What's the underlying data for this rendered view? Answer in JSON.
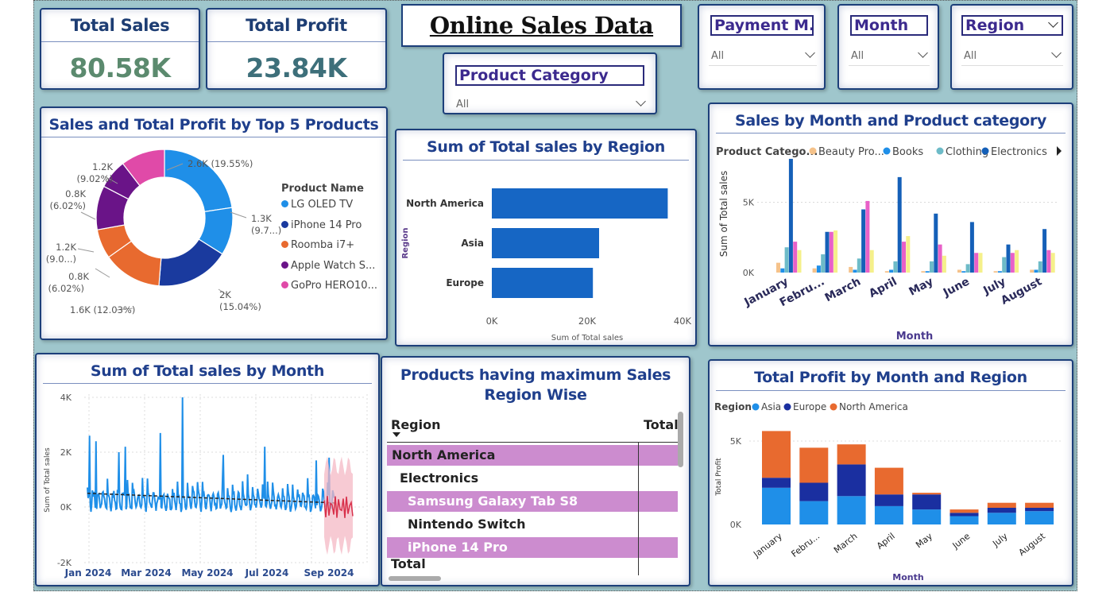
{
  "dashboard_title": "Online Sales Data",
  "kpis": [
    {
      "title": "Total Sales",
      "value": "80.58K",
      "color": "#5b8a6e"
    },
    {
      "title": "Total Profit",
      "value": "23.84K",
      "color": "#3d6f7a"
    }
  ],
  "slicers": {
    "product_category": {
      "label": "Product Category",
      "value": "All"
    },
    "payment": {
      "label": "Payment M...",
      "value": "All"
    },
    "month": {
      "label": "Month",
      "value": "All"
    },
    "region": {
      "label": "Region",
      "value": "All"
    }
  },
  "donut": {
    "title": "Sales and Total Profit by Top 5 Products",
    "legend_title": "Product Name",
    "colors": [
      "#1f8fe8",
      "#1a3a9e",
      "#e86a2f",
      "#6a1488",
      "#e04aa8"
    ],
    "labels_text": [
      "2.6K (19.55%)",
      "1.3K",
      "(9.7...)",
      "2K",
      "(15.04%)",
      "1.6K (12.03%)",
      "0.8K",
      "(6.02%)",
      "1.2K",
      "(9.0...)",
      "0.8K",
      "(6.02%)",
      "1.2K",
      "(9.02%)"
    ]
  },
  "region_bar": {
    "title": "Sum of Total sales by Region",
    "ylabel": "Region",
    "xlabel": "Sum of Total sales",
    "ticks": [
      "0K",
      "20K",
      "40K"
    ]
  },
  "month_category": {
    "title": "Sales by Month and Product category",
    "legend_title": "Product Catego...",
    "legend": [
      "Beauty Pro...",
      "Books",
      "Clothing",
      "Electronics"
    ],
    "ylabel": "Sum of Total sales",
    "xlabel": "Month",
    "yticks": [
      "5K",
      "0K"
    ],
    "months": [
      "January",
      "Febru...",
      "March",
      "April",
      "May",
      "June",
      "July",
      "August"
    ],
    "colors": [
      "#f5c28a",
      "#1f8fe8",
      "#6dbbc8",
      "#1560b8",
      "#e860c8",
      "#f5f08a"
    ]
  },
  "line": {
    "title": "Sum of Total sales by Month",
    "ylabel": "Sum of Total sales",
    "yticks": [
      "4K",
      "2K",
      "0K",
      "-2K"
    ],
    "xticks": [
      "Jan 2024",
      "Mar 2024",
      "May 2024",
      "Jul 2024",
      "Sep 2024"
    ]
  },
  "table": {
    "title_line1": "Products having maximum Sales",
    "title_line2": "Region Wise",
    "col_region": "Region",
    "col_total": "Total",
    "rows": [
      {
        "text": "North America",
        "level": 0,
        "hl": true
      },
      {
        "text": "Electronics",
        "level": 1,
        "hl": false
      },
      {
        "text": "Samsung Galaxy Tab S8",
        "level": 2,
        "hl": true
      },
      {
        "text": "Nintendo Switch",
        "level": 2,
        "hl": false
      },
      {
        "text": "iPhone 14 Pro",
        "level": 2,
        "hl": true
      }
    ],
    "total_label": "Total"
  },
  "profit_region": {
    "title": "Total Profit by Month and Region",
    "legend_title": "Region",
    "legend": [
      "Asia",
      "Europe",
      "North America"
    ],
    "colors": [
      "#1f8fe8",
      "#1a2fa0",
      "#e86a2f"
    ],
    "ylabel": "Total Profit",
    "xlabel": "Month",
    "yticks": [
      "5K",
      "0K"
    ],
    "months": [
      "January",
      "Febru...",
      "March",
      "April",
      "May",
      "June",
      "July",
      "August"
    ]
  },
  "chart_data": [
    {
      "type": "pie",
      "title": "Sales and Total Profit by Top 5 Products",
      "categories": [
        "LG OLED TV",
        "iPhone 14 Pro",
        "Roomba i7+",
        "Apple Watch S...",
        "GoPro HERO10..."
      ],
      "values": [
        2600,
        1300,
        2000,
        1600,
        800,
        1200,
        800,
        1200
      ],
      "segment_names": [
        "LG OLED TV",
        "LG OLED TV",
        "iPhone 14 Pro",
        "Roomba i7+",
        "Roomba i7+",
        "Apple Watch S...",
        "Apple Watch S...",
        "GoPro HERO10..."
      ],
      "segment_colors": [
        0,
        0,
        1,
        2,
        2,
        3,
        3,
        4
      ]
    },
    {
      "type": "bar",
      "title": "Sum of Total sales by Region",
      "categories": [
        "North America",
        "Asia",
        "Europe"
      ],
      "values": [
        36900,
        22500,
        21200
      ],
      "xlim": [
        0,
        40000
      ]
    },
    {
      "type": "bar",
      "title": "Sales by Month and Product category",
      "categories": [
        "January",
        "Febru...",
        "March",
        "April",
        "May",
        "June",
        "July",
        "August"
      ],
      "series": [
        {
          "name": "Beauty Pro...",
          "values": [
            700,
            300,
            400,
            100,
            100,
            200,
            100,
            200
          ]
        },
        {
          "name": "Books",
          "values": [
            300,
            500,
            200,
            200,
            100,
            100,
            100,
            200
          ]
        },
        {
          "name": "Clothing",
          "values": [
            1800,
            1300,
            1000,
            800,
            800,
            600,
            1100,
            800
          ]
        },
        {
          "name": "Electronics",
          "values": [
            8100,
            2900,
            4500,
            6800,
            4200,
            3600,
            2000,
            3100
          ]
        },
        {
          "name": "",
          "values": [
            2200,
            2900,
            5100,
            2200,
            2000,
            1400,
            1400,
            1600
          ]
        },
        {
          "name": "",
          "values": [
            1600,
            3000,
            1600,
            2600,
            1200,
            1400,
            1600,
            1400
          ]
        }
      ],
      "ylim": [
        0,
        9000
      ]
    },
    {
      "type": "line",
      "title": "Sum of Total sales by Month",
      "x_range": [
        "Jan 2024",
        "Sep 2024"
      ],
      "ylim": [
        -2000,
        4000
      ]
    },
    {
      "type": "bar",
      "title": "Total Profit by Month and Region",
      "categories": [
        "January",
        "Febru...",
        "March",
        "April",
        "May",
        "June",
        "July",
        "August"
      ],
      "series": [
        {
          "name": "Asia",
          "values": [
            2200,
            1400,
            1700,
            1100,
            900,
            500,
            700,
            800
          ]
        },
        {
          "name": "Europe",
          "values": [
            600,
            1100,
            1900,
            700,
            900,
            200,
            300,
            200
          ]
        },
        {
          "name": "North America",
          "values": [
            2800,
            2100,
            1200,
            1600,
            100,
            200,
            300,
            300
          ]
        }
      ],
      "ylim": [
        0,
        6000
      ]
    }
  ]
}
